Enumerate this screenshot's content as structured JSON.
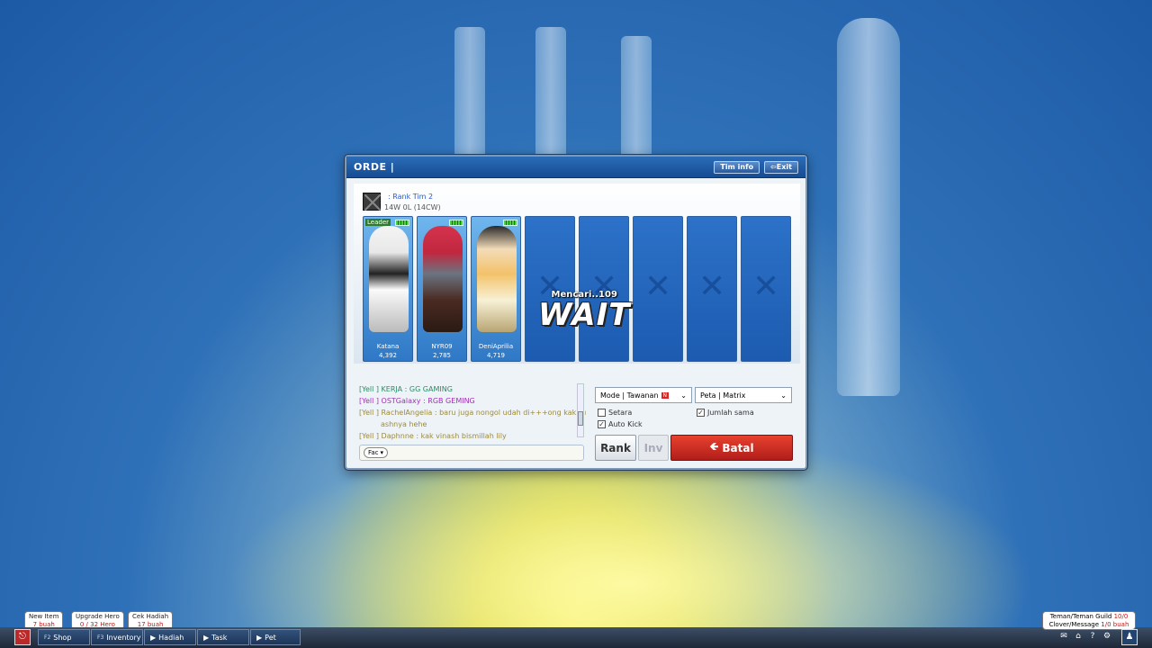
{
  "dialog": {
    "title": "ORDE |",
    "tim_info_label": "Tim info",
    "exit_label": "Exit",
    "team": {
      "rank_name": ": Rank Tim 2",
      "record": "14W 0L (14CW)"
    },
    "players": [
      {
        "name": "Katana",
        "score": "4,392",
        "leader": "Leader"
      },
      {
        "name": "NYR09",
        "score": "2,785"
      },
      {
        "name": "DeniAprilia",
        "score": "4,719"
      }
    ],
    "empty_slot_count": 5,
    "searching_text": "Mencari..109",
    "wait_text": "WAIT",
    "chat": [
      {
        "prefix": "[Yell ]",
        "text": "KERJA : GG GAMING",
        "color": "green"
      },
      {
        "prefix": "[Yell ]",
        "text": "OSTGalaxy : RGB GEMING",
        "color": "purple"
      },
      {
        "prefix": "[Yell ]",
        "text": "RachelAngelia : baru juga nongol udah di+++ong kak vin",
        "color": "olive"
      },
      {
        "prefix": "",
        "text": "ashnya hehe",
        "color": "olive"
      },
      {
        "prefix": "[Yell ]",
        "text": "Daphnne : kak vinash bismillah lily",
        "color": "olive"
      }
    ],
    "chat_channel": "Fac",
    "mode_select": "Mode | Tawanan",
    "mode_badge": "N",
    "map_select": "Peta  |  Matrix",
    "checkboxes": {
      "setara": {
        "label": "Setara",
        "checked": false
      },
      "auto_kick": {
        "label": "Auto Kick",
        "checked": true
      },
      "jumlah_sama": {
        "label": "Jumlah sama",
        "checked": true
      }
    },
    "rank_button": "Rank",
    "inv_button": "Inv",
    "batal_button": "Batal"
  },
  "hud": {
    "notifications": [
      {
        "top": "New Item",
        "bottom": "7 buah"
      },
      {
        "top": "Upgrade Hero",
        "bottom": "0 / 32 Hero"
      },
      {
        "top": "Cek Hadiah",
        "bottom": "17 buah"
      }
    ],
    "taskbar": [
      {
        "key": "F2",
        "label": "Shop"
      },
      {
        "key": "F3",
        "label": "Inventory"
      },
      {
        "key": "",
        "label": "Hadiah"
      },
      {
        "key": "",
        "label": "Task"
      },
      {
        "key": "",
        "label": "Pet"
      }
    ],
    "guild": {
      "line1_label": "Teman/Teman Guild",
      "line1_value": "10/0",
      "line2_label": "Clover/Message",
      "line2_value": "1/0 buah"
    },
    "icons": [
      "mail-icon",
      "home-icon",
      "help-icon",
      "settings-icon",
      "friends-icon"
    ]
  }
}
